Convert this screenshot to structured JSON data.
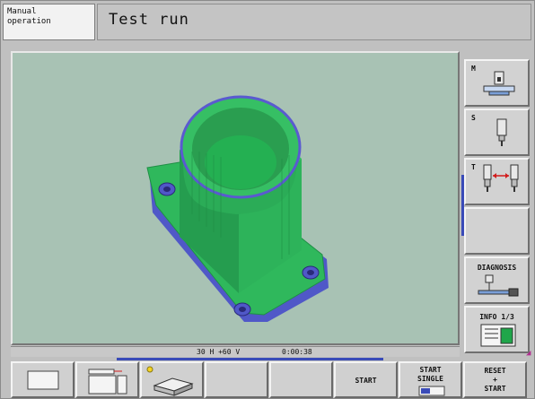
{
  "header": {
    "mode_line1": "Manual",
    "mode_line2": "operation",
    "title": "Test run"
  },
  "status": {
    "angles": "30 H +60 V",
    "time": "0:00:38"
  },
  "side_softkeys": [
    {
      "letter": "M",
      "icon": "machine-table-icon"
    },
    {
      "letter": "S",
      "icon": "spindle-tool-icon"
    },
    {
      "letter": "T",
      "icon": "tool-change-icon"
    },
    {
      "letter": "",
      "icon": ""
    },
    {
      "label": "DIAGNOSIS",
      "icon": "diagnosis-icon"
    },
    {
      "label": "INFO 1/3",
      "icon": "info-sheet-icon"
    }
  ],
  "bottom_softkeys": [
    {
      "label": "",
      "icon": "window-view-icon"
    },
    {
      "label": "",
      "icon": "split-view-icon"
    },
    {
      "label": "",
      "icon": "blank-workpiece-icon"
    },
    {
      "label": ""
    },
    {
      "label": ""
    },
    {
      "label": "START"
    },
    {
      "label_line1": "START",
      "label_line2": "SINGLE",
      "icon": "single-block-icon"
    },
    {
      "label_line1": "RESET",
      "label_line2": "+",
      "label_line3": "START"
    }
  ],
  "colors": {
    "background": "#a8c2b4",
    "part_green": "#27b35a",
    "part_edge_blue": "#5a5ad0",
    "accent_blue": "#3a4bb8"
  }
}
